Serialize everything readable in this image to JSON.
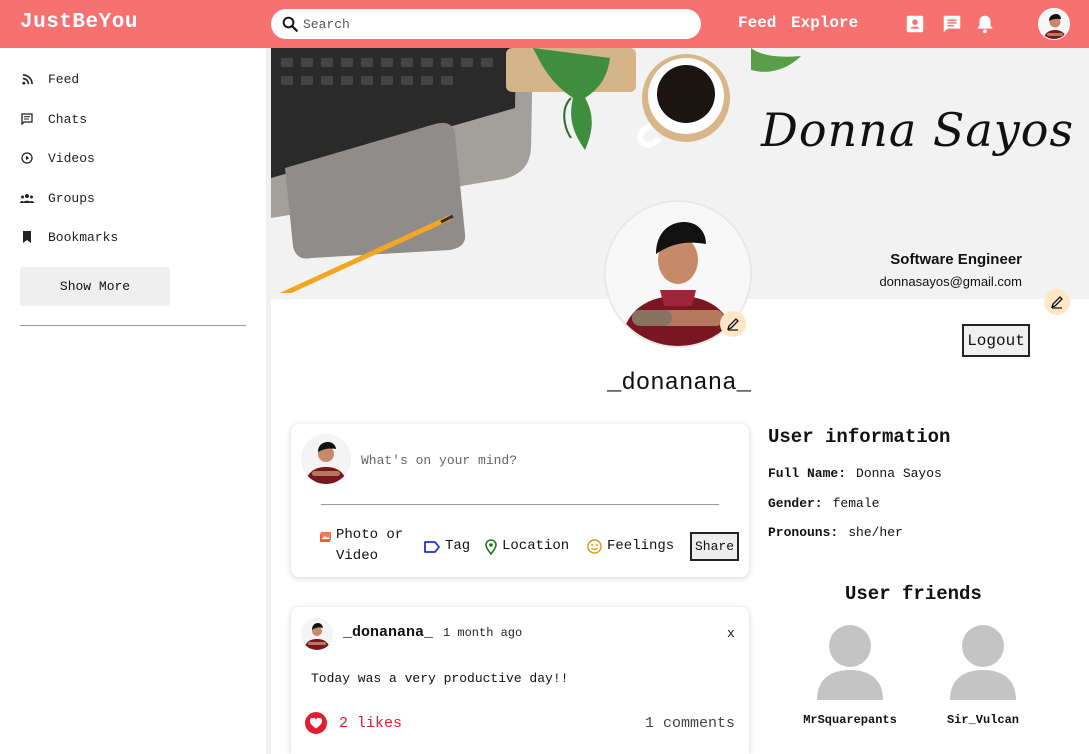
{
  "app": {
    "logo": "JustBeYou"
  },
  "search": {
    "placeholder": "Search"
  },
  "nav": {
    "feed": "Feed",
    "explore": "Explore"
  },
  "sidebar": {
    "items": [
      {
        "label": "Feed",
        "icon": "rss-icon"
      },
      {
        "label": "Chats",
        "icon": "chat-icon"
      },
      {
        "label": "Videos",
        "icon": "play-circle-icon"
      },
      {
        "label": "Groups",
        "icon": "group-icon"
      },
      {
        "label": "Bookmarks",
        "icon": "bookmark-icon"
      }
    ],
    "show_more": "Show More"
  },
  "cover": {
    "signature": "Donna Sayos",
    "job_title": "Software Engineer",
    "email": "donnasayos@gmail.com"
  },
  "profile": {
    "username": "_donanana_",
    "logout": "Logout"
  },
  "composer": {
    "placeholder": "What's on your mind?",
    "actions": {
      "photo_line1": "Photo or",
      "photo_line2": "Video",
      "tag": "Tag",
      "location": "Location",
      "feelings": "Feelings"
    },
    "share": "Share"
  },
  "post": {
    "author": "_donanana_",
    "time": "1 month ago",
    "close": "x",
    "text": "Today was a very productive day!!",
    "likes": "2 likes",
    "comments": "1 comments"
  },
  "user_info": {
    "title": "User information",
    "full_name_label": "Full Name:",
    "full_name": "Donna Sayos",
    "gender_label": "Gender:",
    "gender": "female",
    "pronouns_label": "Pronouns:",
    "pronouns": "she/her"
  },
  "friends": {
    "title": "User friends",
    "list": [
      "MrSquarepants",
      "Sir_Vulcan"
    ]
  },
  "colors": {
    "topbar": "#f87171",
    "accent_red": "#e11d2e",
    "edit_badge": "#fde7c7"
  }
}
